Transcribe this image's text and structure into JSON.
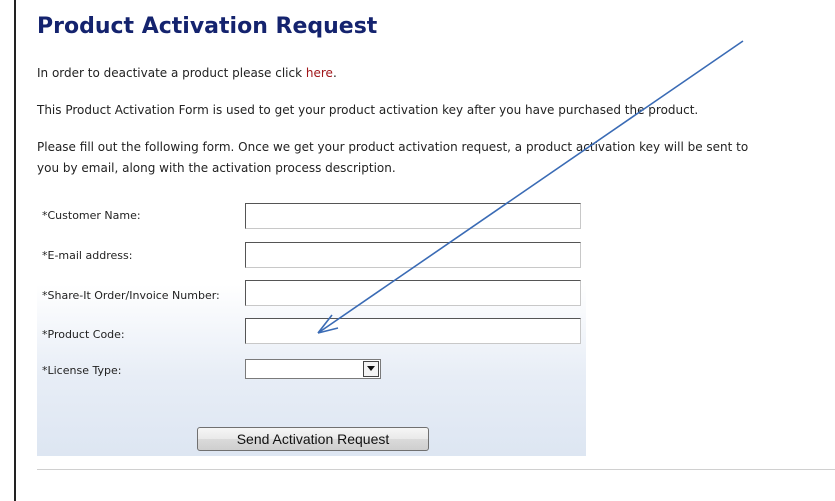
{
  "page": {
    "title": "Product Activation Request"
  },
  "intro": {
    "deactivate_text": "In order to deactivate a product please click ",
    "deactivate_link": "here",
    "deactivate_suffix": ".",
    "form_purpose": "This Product Activation Form is used to get your product activation key after you have purchased the product.",
    "instructions_line1": "Please fill out the following form. Once we get your product activation request, a product activation key will be sent to",
    "instructions_line2": "you by email, along with the activation process description."
  },
  "form": {
    "customer_name_label": "*Customer Name:",
    "customer_name_value": "",
    "email_label": "*E-mail address:",
    "email_value": "",
    "order_number_label": "*Share-It Order/Invoice Number:",
    "order_number_value": "",
    "product_code_label": "*Product Code:",
    "product_code_value": "",
    "license_type_label": "*License Type:",
    "license_type_value": "",
    "submit_label": "Send Activation Request"
  },
  "colors": {
    "title": "#14236e",
    "link": "#a0161a",
    "annotation_arrow": "#3a6bb5"
  },
  "icons": {
    "dropdown": "chevron-down-icon",
    "annotation": "annotation-arrow-icon"
  }
}
